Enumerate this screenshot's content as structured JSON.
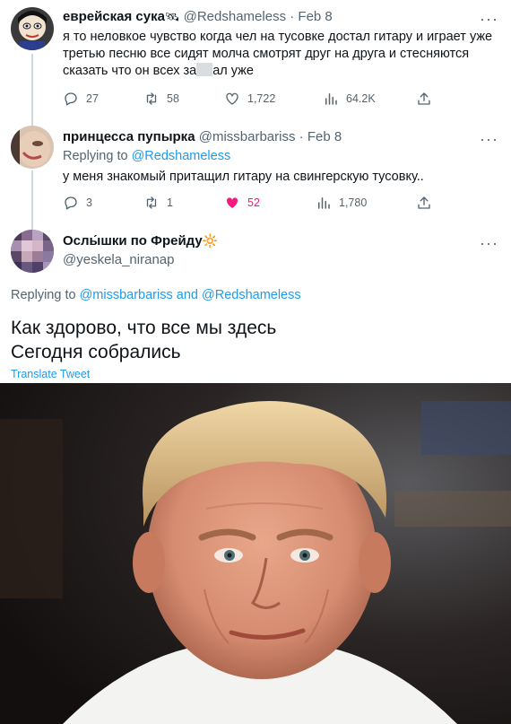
{
  "tweets": [
    {
      "name": "еврейская сука",
      "name_emoji": "🛰",
      "handle": "@Redshameless",
      "dot": "·",
      "date": "Feb 8",
      "more": "···",
      "text_before": "я то неловкое чувство когда чел на тусовке достал гитару и играет уже третью песню все сидят молча смотрят друг на друга и стесняются сказать что он всех за",
      "text_after": "ал уже",
      "stats": {
        "replies": "27",
        "retweets": "58",
        "likes": "1,722",
        "views": "64.2K"
      }
    },
    {
      "name": "принцесса пупырка",
      "handle": "@missbarbariss",
      "dot": "·",
      "date": "Feb 8",
      "more": "···",
      "replying_label": "Replying to",
      "replying_to": "@Redshameless",
      "text": "у меня знакомый притащил гитару на свингерскую тусовку..",
      "stats": {
        "replies": "3",
        "retweets": "1",
        "likes": "52",
        "views": "1,780"
      }
    },
    {
      "name": "Ослы́шки по Фрейду",
      "name_emoji": "🔆",
      "handle": "@yeskela_niranap",
      "more": "···",
      "replying_label": "Replying to",
      "replying_to_1": "@missbarbariss",
      "replying_and": "and",
      "replying_to_2": "@Redshameless",
      "text_line1": "Как здорово, что все мы здесь",
      "text_line2": "Сегодня собрались",
      "translate": "Translate Tweet"
    }
  ],
  "colors": {
    "accent": "#1d9bf0",
    "like": "#f91880",
    "muted": "#536471"
  },
  "icons": [
    "reply-icon",
    "retweet-icon",
    "like-icon",
    "views-icon",
    "share-icon",
    "more-icon"
  ]
}
